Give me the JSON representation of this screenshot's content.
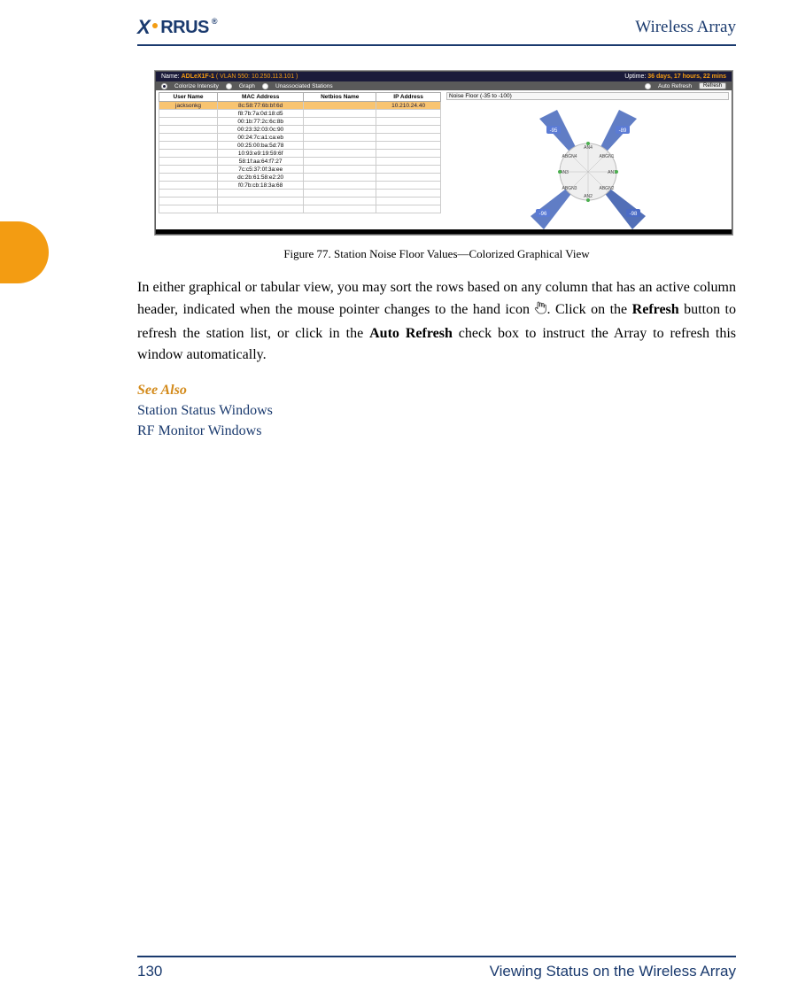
{
  "header": {
    "logo_text_1": "X",
    "logo_text_2": "RRUS",
    "logo_reg": "®",
    "doc_title": "Wireless Array"
  },
  "screenshot": {
    "titlebar": {
      "name_label": "Name:",
      "name_value": "ADLeX1F-1",
      "vlan": "( VLAN 550: 10.250.113.101 )",
      "uptime_label": "Uptime:",
      "uptime_value": "36 days, 17 hours, 22 mins"
    },
    "subbar": {
      "colorize": "Colorize Intensity",
      "graph": "Graph",
      "unassoc": "Unassociated Stations",
      "auto_refresh": "Auto Refresh",
      "refresh": "Refresh"
    },
    "noise_floor_label": "Noise Floor (-35 to -100)",
    "table": {
      "headers": [
        "User Name",
        "MAC Address",
        "Netbios Name",
        "IP Address"
      ],
      "rows": [
        {
          "user": "jacksonkg",
          "mac": "8c:58:77:6b:bf:6d",
          "netbios": "",
          "ip": "10.210.24.40",
          "hl": true
        },
        {
          "user": "",
          "mac": "f8:7b:7a:0d:18:d5",
          "netbios": "",
          "ip": "",
          "hl": false
        },
        {
          "user": "",
          "mac": "00:1b:77:2c:6c:8b",
          "netbios": "",
          "ip": "",
          "hl": false
        },
        {
          "user": "",
          "mac": "00:23:32:03:0c:90",
          "netbios": "",
          "ip": "",
          "hl": false
        },
        {
          "user": "",
          "mac": "00:24:7c:a1:ca:eb",
          "netbios": "",
          "ip": "",
          "hl": false
        },
        {
          "user": "",
          "mac": "00:25:00:ba:5d:78",
          "netbios": "",
          "ip": "",
          "hl": false
        },
        {
          "user": "",
          "mac": "10:93:e9:19:59:6f",
          "netbios": "",
          "ip": "",
          "hl": false
        },
        {
          "user": "",
          "mac": "58:1f:aa:64:f7:27",
          "netbios": "",
          "ip": "",
          "hl": false
        },
        {
          "user": "",
          "mac": "7c:c5:37:0f:3a:ee",
          "netbios": "",
          "ip": "",
          "hl": false
        },
        {
          "user": "",
          "mac": "dc:2b:61:58:e2:20",
          "netbios": "",
          "ip": "",
          "hl": false
        },
        {
          "user": "",
          "mac": "f0:7b:cb:18:3a:68",
          "netbios": "",
          "ip": "",
          "hl": false
        }
      ]
    },
    "radial": {
      "sectors": [
        "AN4",
        "ABGN1",
        "AN1",
        "ABGN2",
        "AN2",
        "ABGN3",
        "AN3",
        "ABGN4"
      ],
      "badges": [
        "-95",
        "-89",
        "-98",
        "-96"
      ]
    }
  },
  "figure_caption": "Figure 77. Station Noise Floor Values—Colorized Graphical View",
  "body": {
    "p1a": "In either graphical or tabular view, you may sort the rows based on any column that has an active column header, indicated when the mouse pointer changes to the hand icon ",
    "p1b": ". Click on the ",
    "refresh": "Refresh",
    "p1c": " button to refresh the station list, or click in the ",
    "auto_refresh": "Auto Refresh",
    "p1d": " check box to instruct the Array to refresh this window automatically."
  },
  "see_also": {
    "heading": "See Also",
    "links": [
      "Station Status Windows",
      "RF Monitor Windows"
    ]
  },
  "footer": {
    "page_number": "130",
    "section": "Viewing Status on the Wireless Array"
  }
}
